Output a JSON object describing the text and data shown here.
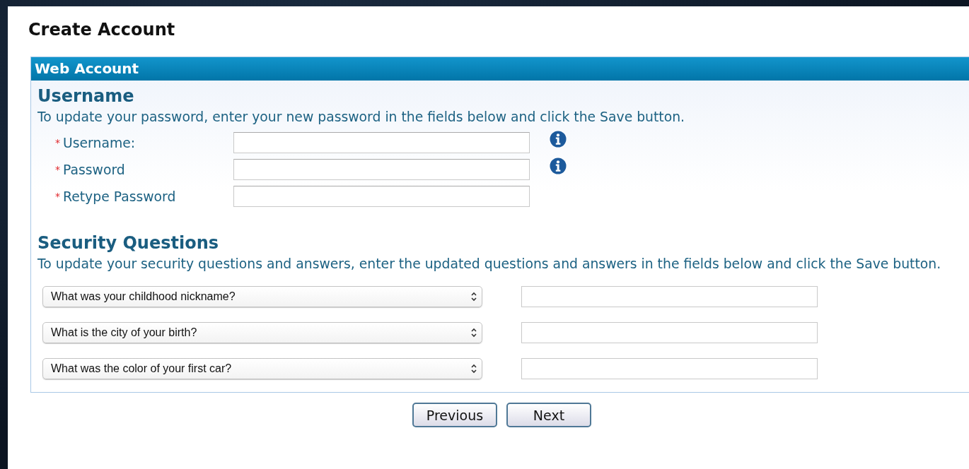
{
  "page_title": "Create Account",
  "panel": {
    "title": "Web Account",
    "sections": [
      {
        "kind": "fields",
        "heading": "Username",
        "description": "To update your password, enter your new password in the fields below and click the Save button.",
        "fields": [
          {
            "required_mark": "*",
            "label": "Username:",
            "info": true
          },
          {
            "required_mark": "*",
            "label": "Password",
            "info": true
          },
          {
            "required_mark": "*",
            "label": "Retype Password",
            "info": false
          }
        ]
      },
      {
        "kind": "questions",
        "heading": "Security Questions",
        "description": "To update your security questions and answers, enter the updated questions and answers in the fields below and click the Save button.",
        "questions": [
          {
            "question": "What was your childhood nickname?"
          },
          {
            "question": "What is the city of your birth?"
          },
          {
            "question": "What was the color of your first car?"
          }
        ]
      }
    ]
  },
  "buttons": [
    "Previous",
    "Next"
  ]
}
